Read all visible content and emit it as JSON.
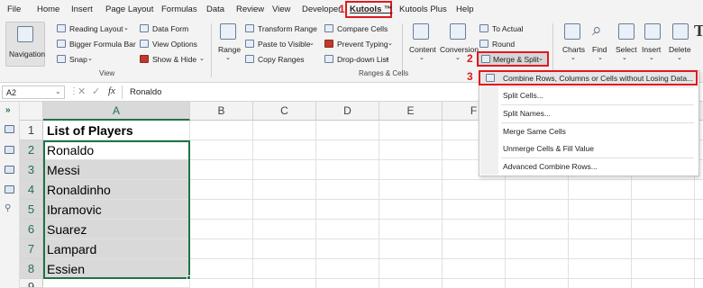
{
  "menu": {
    "tabs": [
      "File",
      "Home",
      "Insert",
      "Page Layout",
      "Formulas",
      "Data",
      "Review",
      "View",
      "Developer",
      "Kutools ™",
      "Kutools Plus",
      "Help"
    ],
    "markers": {
      "m1": "1",
      "m2": "2",
      "m3": "3"
    }
  },
  "ribbon": {
    "navigation": "Navigation",
    "reading_layout": "Reading Layout",
    "bigger_formula_bar": "Bigger Formula Bar",
    "snap": "Snap",
    "data_form": "Data Form",
    "view_options": "View Options",
    "show_hide": "Show & Hide",
    "view_group": "View",
    "range": "Range",
    "transform_range": "Transform Range",
    "paste_to_visible": "Paste to Visible",
    "copy_ranges": "Copy Ranges",
    "compare_cells": "Compare Cells",
    "prevent_typing": "Prevent Typing",
    "dropdown_list": "Drop-down List",
    "content": "Content",
    "conversion": "Conversion",
    "to_actual": "To Actual",
    "round": "Round",
    "merge_split": "Merge & Split",
    "ranges_cells_group": "Ranges & Cells",
    "charts": "Charts",
    "find": "Find",
    "select": "Select",
    "insert": "Insert",
    "delete": "Delete",
    "text_glyph": "T"
  },
  "formula_bar": {
    "name_box": "A2",
    "fx": "fx",
    "value": "Ronaldo"
  },
  "grid": {
    "columns": [
      "A",
      "B",
      "C",
      "D",
      "E",
      "F"
    ],
    "rows": [
      "1",
      "2",
      "3",
      "4",
      "5",
      "6",
      "7",
      "8",
      "9"
    ],
    "cells": [
      "List of Players",
      "Ronaldo",
      "Messi",
      "Ronaldinho",
      "Ibramovic",
      "Suarez",
      "Lampard",
      "Essien"
    ]
  },
  "dropdown": {
    "items": [
      "Combine Rows, Columns or Cells without Losing Data...",
      "Split Cells...",
      "Split Names...",
      "Merge Same Cells",
      "Unmerge Cells & Fill Value",
      "Advanced Combine Rows..."
    ]
  },
  "colors": {
    "accent_red": "#e0191f",
    "selection_green": "#217346",
    "selection_fill": "#d9d9d9"
  }
}
